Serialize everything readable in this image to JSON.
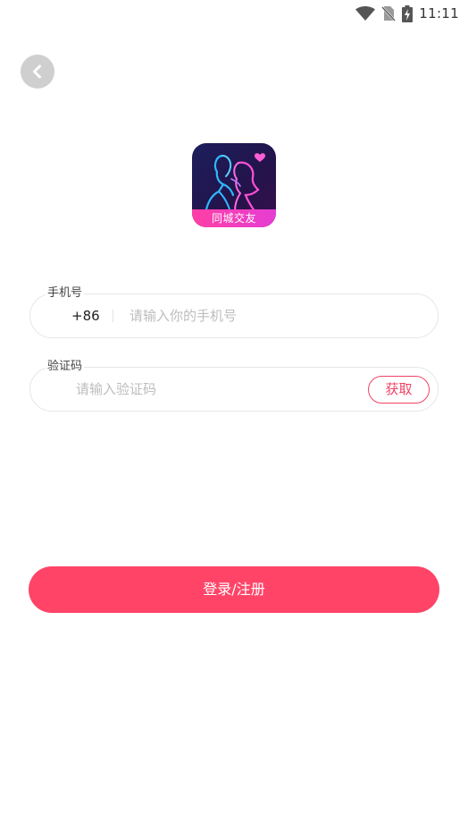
{
  "status_bar": {
    "time": "11:11",
    "icons": [
      "wifi-icon",
      "no-sim-icon",
      "battery-charging-icon"
    ]
  },
  "nav": {
    "back_icon": "chevron-left-icon"
  },
  "logo": {
    "banner_text": "同城交友",
    "colors": {
      "background": "#1a1240",
      "neon_blue": "#29b6ff",
      "neon_pink": "#ff4fd8"
    }
  },
  "form": {
    "phone": {
      "label": "手机号",
      "prefix": "+86",
      "value": "",
      "placeholder": "请输入你的手机号"
    },
    "code": {
      "label": "验证码",
      "value": "",
      "placeholder": "请输入验证码",
      "get_button": "获取"
    }
  },
  "submit": {
    "label": "登录/注册"
  },
  "colors": {
    "accent": "#ff4468",
    "back_button_bg": "#cfcfcf",
    "field_border": "#e6e6e6"
  }
}
